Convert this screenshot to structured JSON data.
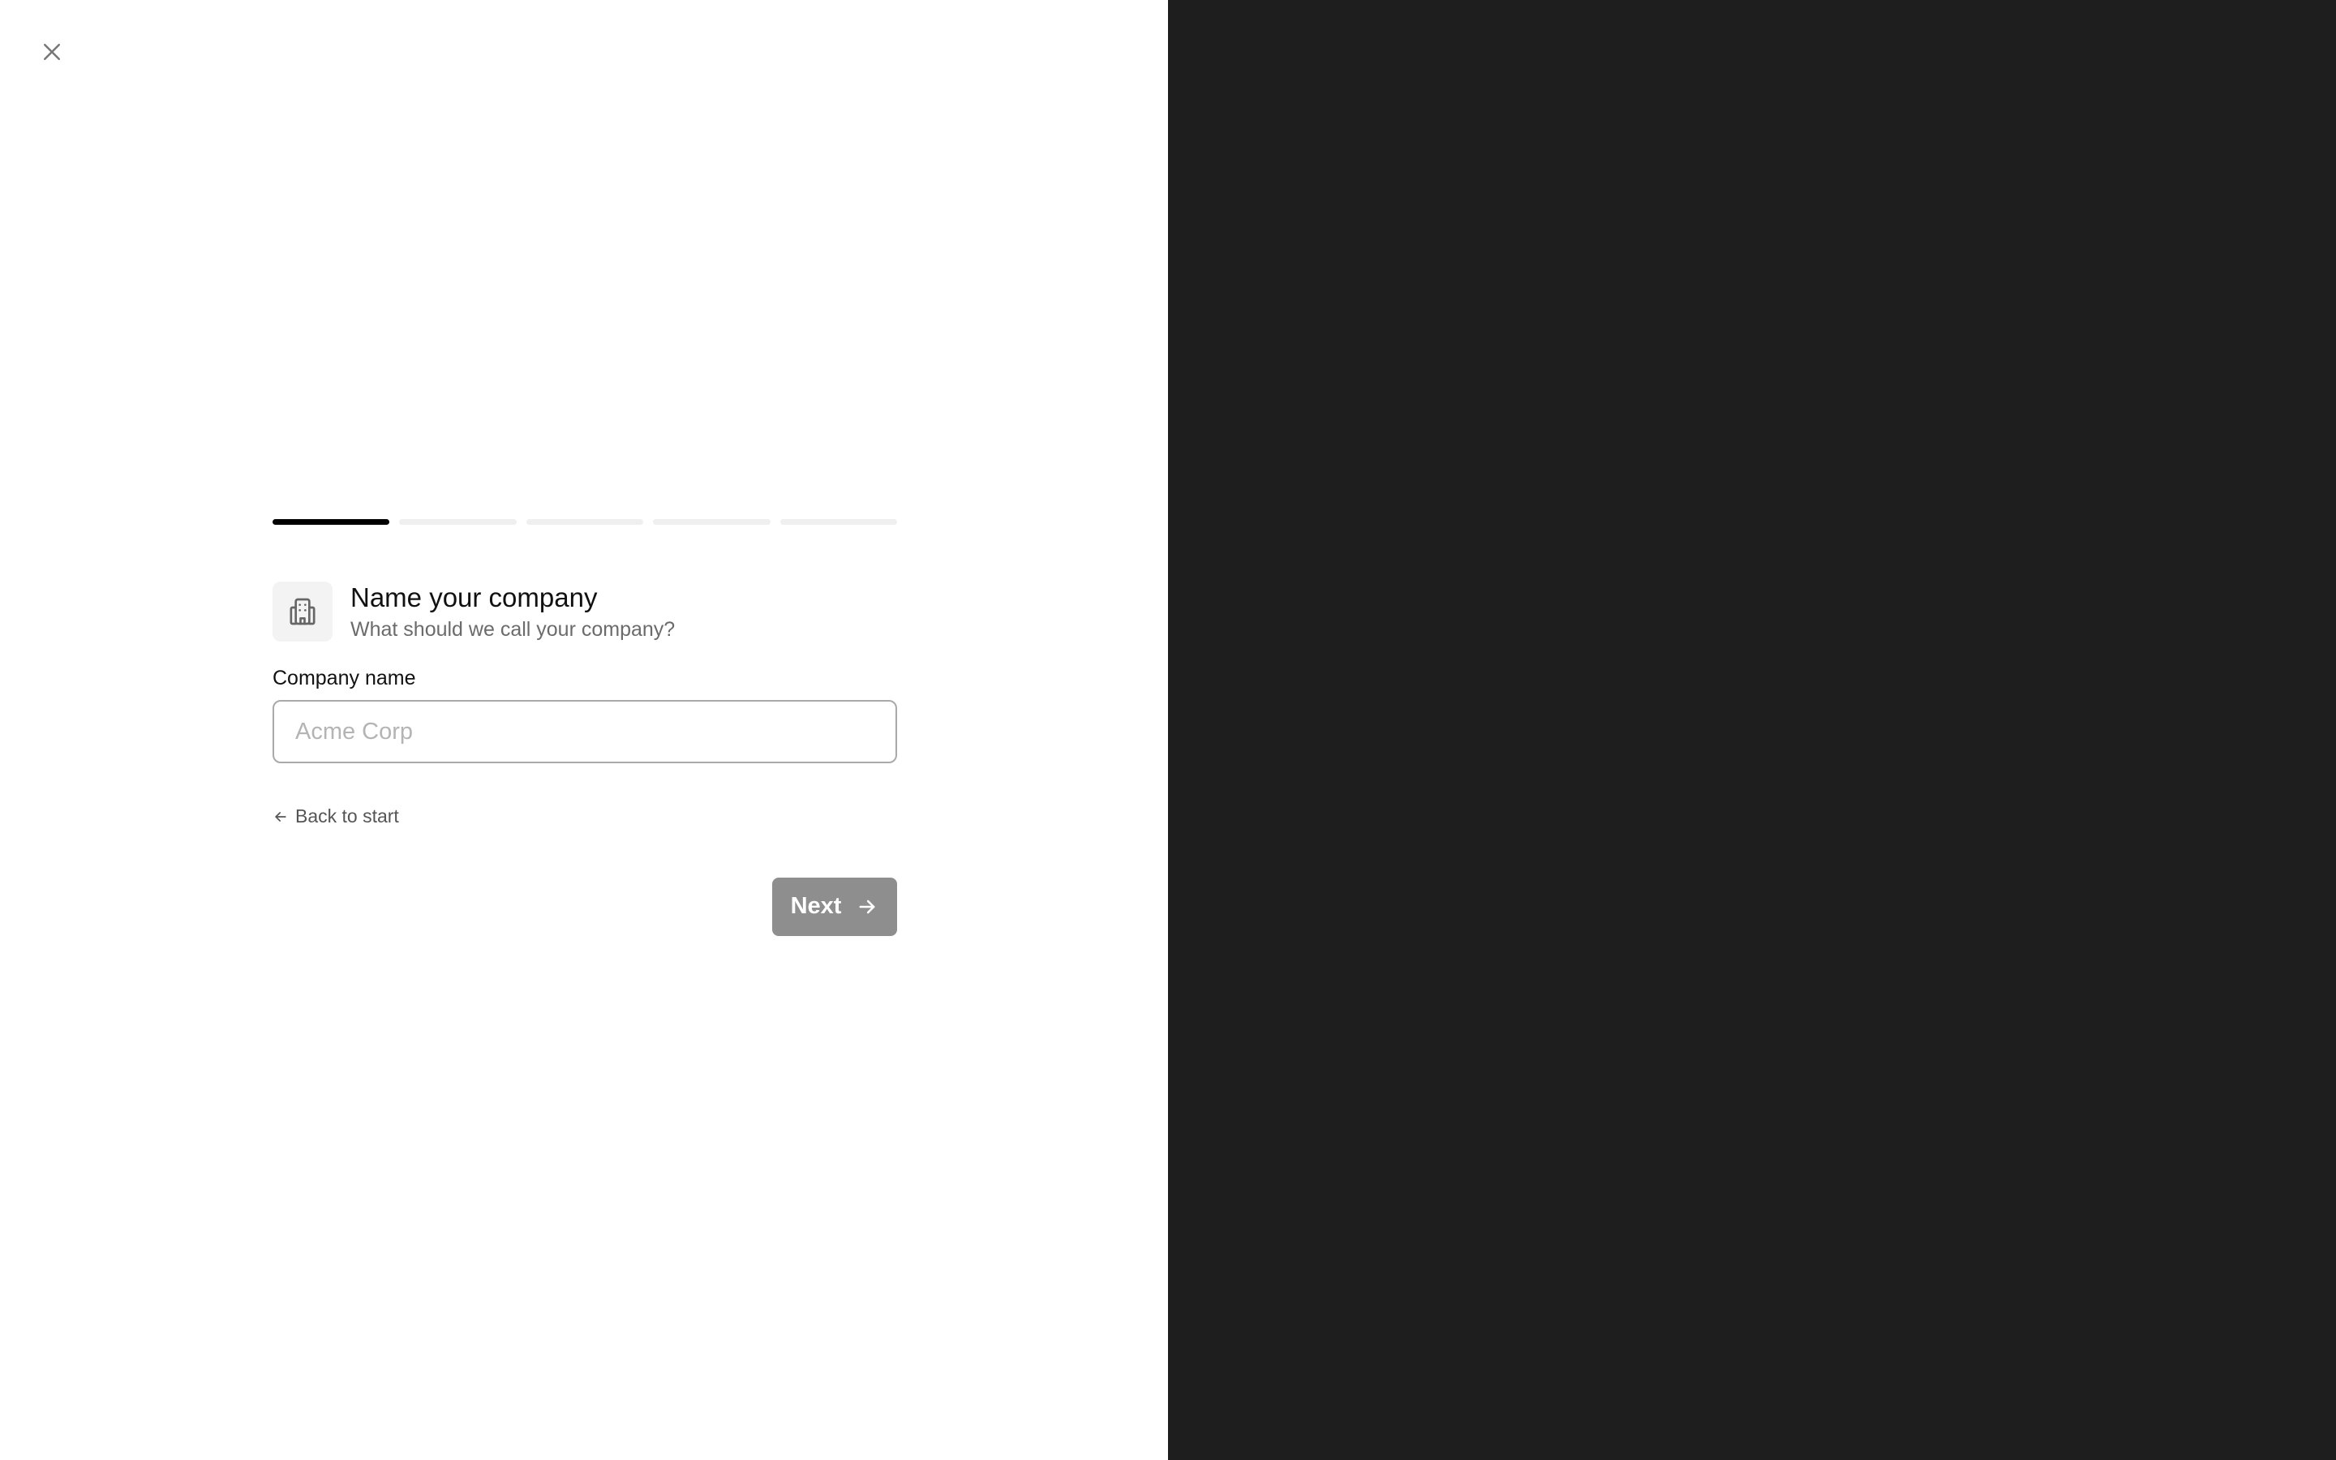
{
  "progress": {
    "total_steps": 5,
    "current_step": 1
  },
  "header": {
    "title": "Name your company",
    "subtitle": "What should we call your company?",
    "icon": "building-icon"
  },
  "form": {
    "company_label": "Company name",
    "company_value": "",
    "company_placeholder": "Acme Corp"
  },
  "nav": {
    "back_label": "Back to start",
    "next_label": "Next"
  },
  "colors": {
    "right_panel": "#1e1e1e",
    "progress_active": "#000000",
    "progress_inactive": "#efefef",
    "next_button_disabled": "#8e8e8e"
  }
}
